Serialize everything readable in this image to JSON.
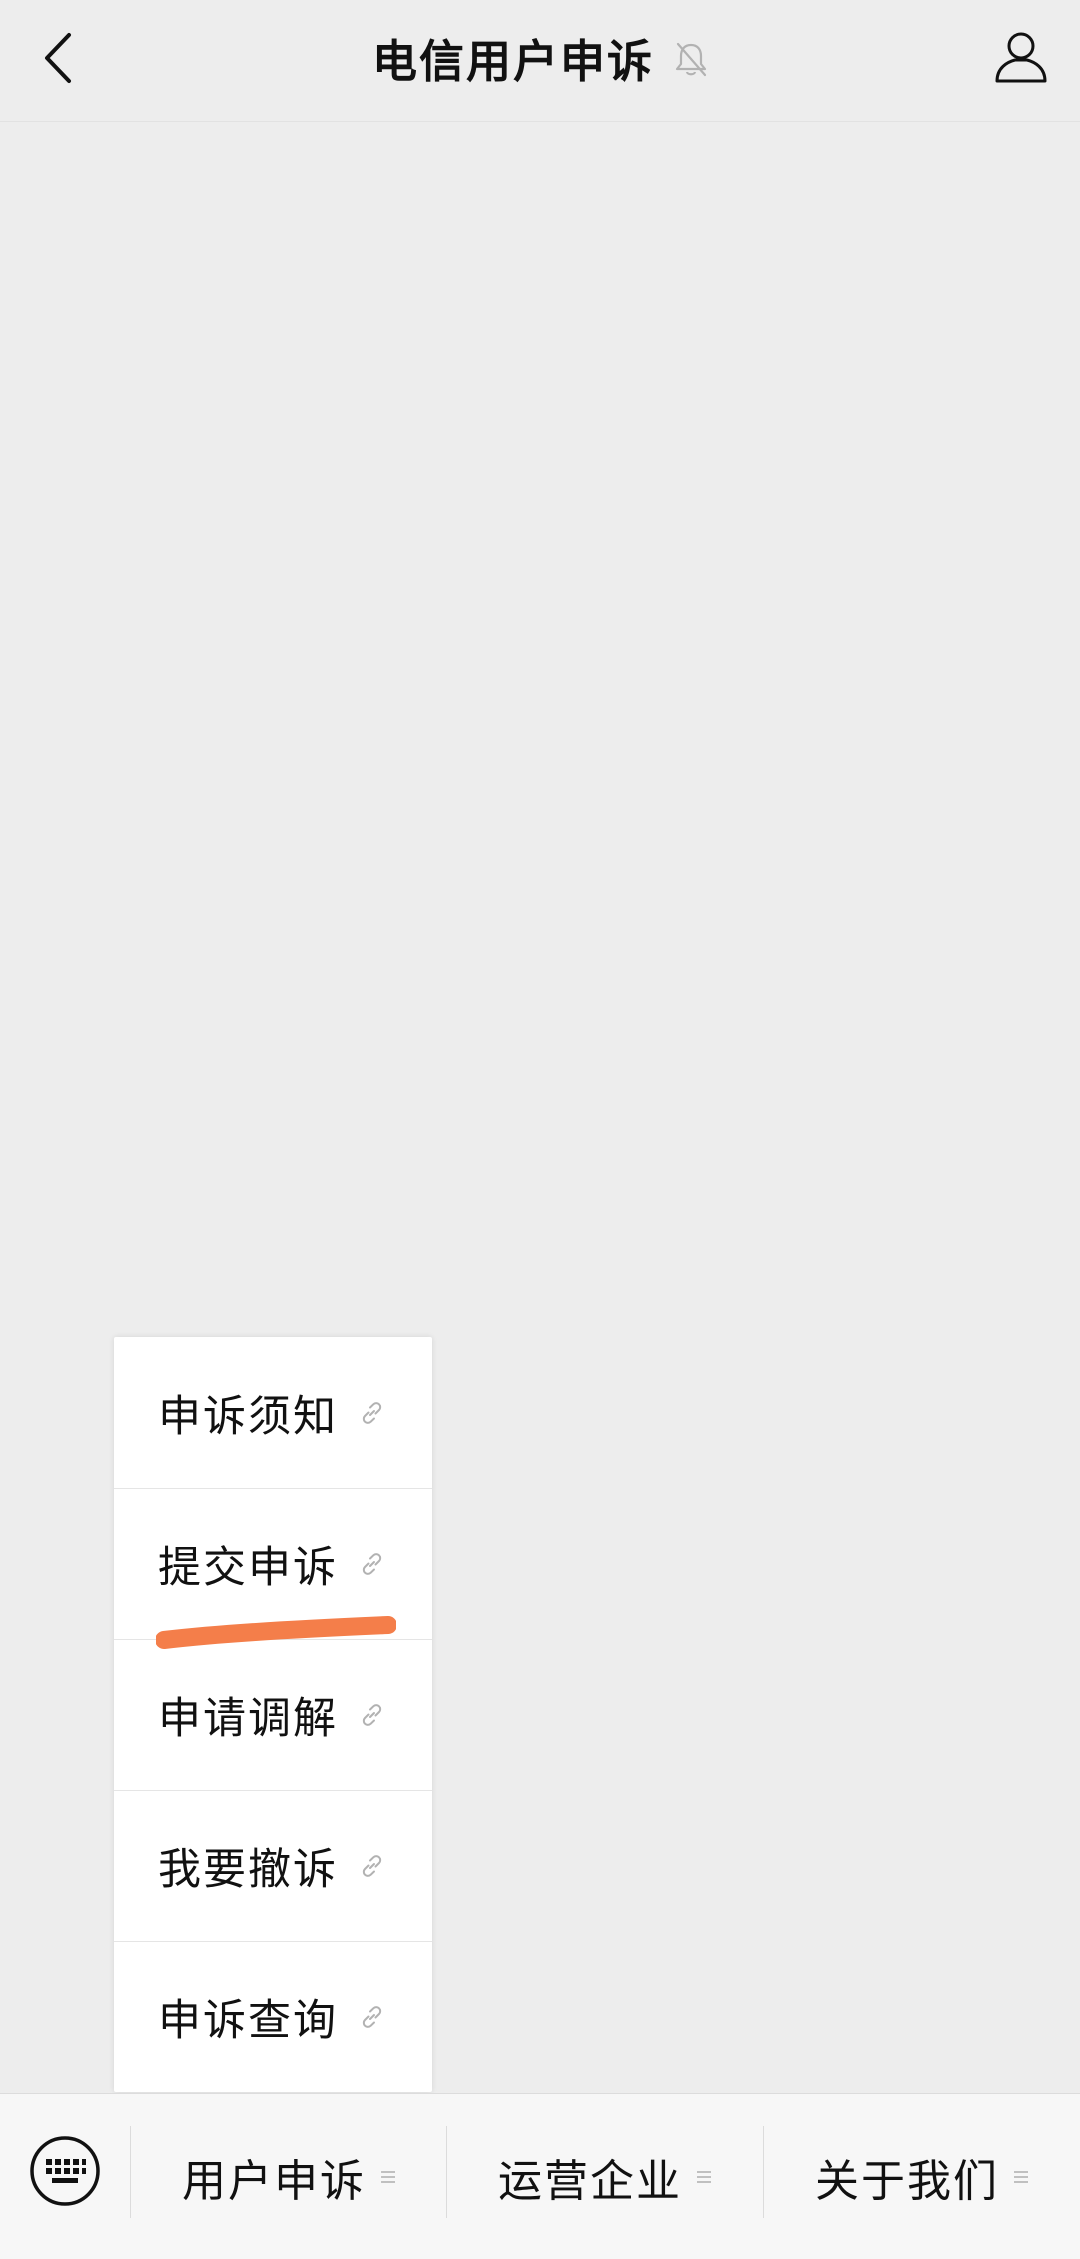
{
  "header": {
    "title": "电信用户申诉",
    "back_icon": "chevron-left-icon",
    "mute_icon": "bell-off-icon",
    "profile_icon": "user-profile-icon"
  },
  "submenu": {
    "items": [
      {
        "label": "申诉须知",
        "icon": "link-icon"
      },
      {
        "label": "提交申诉",
        "icon": "link-icon"
      },
      {
        "label": "申请调解",
        "icon": "link-icon"
      },
      {
        "label": "我要撤诉",
        "icon": "link-icon"
      },
      {
        "label": "申诉查询",
        "icon": "link-icon"
      }
    ],
    "highlight_color": "#f47e4a"
  },
  "bottom_bar": {
    "keyboard_icon": "keyboard-icon",
    "tabs": [
      {
        "label": "用户申诉",
        "icon": "menu-lines-icon"
      },
      {
        "label": "运营企业",
        "icon": "menu-lines-icon"
      },
      {
        "label": "关于我们",
        "icon": "menu-lines-icon"
      }
    ]
  },
  "colors": {
    "background": "#ededed",
    "bar_background": "#f7f7f7",
    "text": "#111111",
    "icon_muted": "#b2b2b2"
  }
}
